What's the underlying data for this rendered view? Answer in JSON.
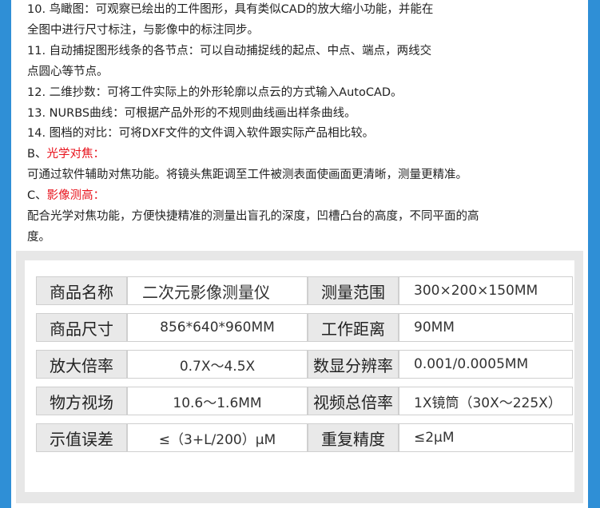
{
  "lines": [
    {
      "text": "10. 鸟瞰图：可观察已绘出的工件图形，具有类似CAD的放大缩小功能，并能在",
      "color": "#222222"
    },
    {
      "text": "全图中进行尺寸标注，与影像中的标注同步。",
      "color": "#222222"
    },
    {
      "text": "11. 自动捕捉图形线条的各节点：可以自动捕捉线的起点、中点、端点，两线交",
      "color": "#222222"
    },
    {
      "text": "点圆心等节点。",
      "color": "#222222"
    },
    {
      "text": "12. 二维抄数：可将工件实际上的外形轮廓以点云的方式输入AutoCAD。",
      "color": "#222222"
    },
    {
      "text": "13. NURBS曲线：可根据产品外形的不规则曲线画出样条曲线。",
      "color": "#222222"
    },
    {
      "text": "14. 图档的对比：可将DXF文件的文件调入软件跟实际产品相比较。",
      "color": "#222222"
    },
    {
      "prefix": "B、",
      "text": "光学对焦：",
      "color": "#e8131c"
    },
    {
      "text": "可通过软件辅助对焦功能。将镜头焦距调至工件被测表面使画面更清晰，测量更精准。",
      "color": "#222222"
    },
    {
      "prefix": "C、",
      "text": "影像测高：",
      "color": "#e8131c"
    },
    {
      "text": "配合光学对焦功能，方便快捷精准的测量出盲孔的深度，凹槽凸台的高度，不同平面的高",
      "color": "#222222"
    },
    {
      "text": "度。",
      "color": "#222222"
    }
  ],
  "specs": [
    {
      "label1": "商品名称",
      "value1": "二次元影像测量仪",
      "label2": "测量范围",
      "value2": "300×200×150MM"
    },
    {
      "label1": "商品尺寸",
      "value1": "856*640*960MM",
      "label2": "工作距离",
      "value2": "90MM"
    },
    {
      "label1": "放大倍率",
      "value1": "0.7X～4.5X",
      "label2": "数显分辨率",
      "value2": "0.001/0.0005MM"
    },
    {
      "label1": "物方视场",
      "value1": "10.6～1.6MM",
      "label2": "视频总倍率",
      "value2": "1X镜筒（30X～225X）"
    },
    {
      "label1": "示值误差",
      "value1": "≤（3+L/200）μM",
      "label2": "重复精度",
      "value2": "≤2μM"
    }
  ],
  "colors": {
    "background": "#2f8fd6",
    "accent": "#e8131c"
  }
}
